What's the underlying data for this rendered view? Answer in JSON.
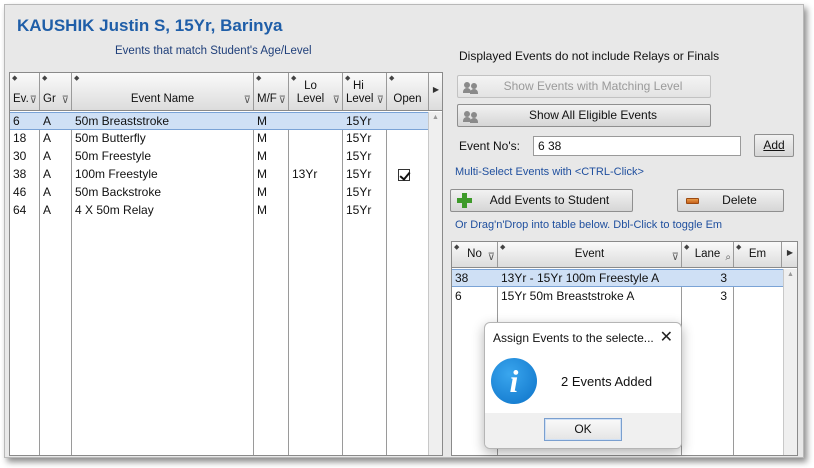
{
  "student": {
    "title": "KAUSHIK Justin S, 15Yr, Barinya",
    "match_caption": "Events that match Student's Age/Level"
  },
  "eligible_table": {
    "headers": {
      "ev": "Ev.",
      "gr": "Gr",
      "event_name": "Event Name",
      "mf": "M/F",
      "lo_level_1": "Lo",
      "lo_level_2": "Level",
      "hi_level_1": "Hi",
      "hi_level_2": "Level",
      "open": "Open"
    },
    "rows": [
      {
        "ev": "6",
        "gr": "A",
        "name": "50m Breaststroke",
        "mf": "M",
        "lo": "",
        "hi": "15Yr",
        "open": false
      },
      {
        "ev": "18",
        "gr": "A",
        "name": "50m Butterfly",
        "mf": "M",
        "lo": "",
        "hi": "15Yr",
        "open": false
      },
      {
        "ev": "30",
        "gr": "A",
        "name": "50m Freestyle",
        "mf": "M",
        "lo": "",
        "hi": "15Yr",
        "open": false
      },
      {
        "ev": "38",
        "gr": "A",
        "name": "100m Freestyle",
        "mf": "M",
        "lo": "13Yr",
        "hi": "15Yr",
        "open": true
      },
      {
        "ev": "46",
        "gr": "A",
        "name": "50m Backstroke",
        "mf": "M",
        "lo": "",
        "hi": "15Yr",
        "open": false
      },
      {
        "ev": "64",
        "gr": "A",
        "name": "4 X 50m Relay",
        "mf": "M",
        "lo": "",
        "hi": "15Yr",
        "open": false
      }
    ],
    "selected_row": 0
  },
  "right_panel": {
    "info_note": "Displayed Events do not include Relays or Finals",
    "show_matching_label": "Show Events with Matching Level",
    "show_all_label": "Show All Eligible Events",
    "event_nos_label": "Event No's:",
    "event_nos_value": "6 38",
    "add_label": "Add",
    "multi_select_hint": "Multi-Select Events with <CTRL-Click>",
    "add_events_label": "Add Events to Student",
    "delete_label": "Delete",
    "drag_hint": "Or Drag'n'Drop into table below.  Dbl-Click to toggle Em"
  },
  "assigned_table": {
    "headers": {
      "no": "No",
      "event": "Event",
      "lane": "Lane",
      "em": "Em"
    },
    "rows": [
      {
        "no": "38",
        "event": "13Yr - 15Yr 100m Freestyle A",
        "lane": "3",
        "em": ""
      },
      {
        "no": "6",
        "event": "15Yr 50m Breaststroke A",
        "lane": "3",
        "em": ""
      }
    ],
    "selected_row": 0
  },
  "dialog": {
    "title": "Assign Events to the selecte...",
    "message": "2 Events Added",
    "ok_label": "OK",
    "icon": "info-icon"
  },
  "colors": {
    "title_blue": "#1f5ea8",
    "hint_blue": "#1f4f9e",
    "selection": "#cfe0f5"
  }
}
